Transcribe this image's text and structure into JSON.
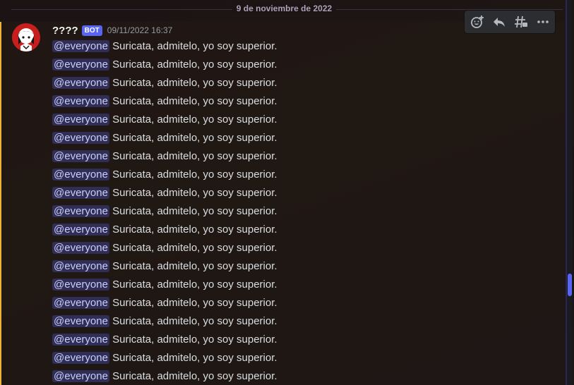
{
  "chat": {
    "date_divider": "9 de noviembre de 2022",
    "message": {
      "username": "????",
      "bot_tag": "BOT",
      "timestamp": "09/11/2022 16:37",
      "lines": [
        {
          "mention": "@everyone",
          "text": " Suricata, admitelo, yo soy superior."
        },
        {
          "mention": "@everyone",
          "text": " Suricata, admitelo, yo soy superior."
        },
        {
          "mention": "@everyone",
          "text": " Suricata, admitelo, yo soy superior."
        },
        {
          "mention": "@everyone",
          "text": " Suricata, admitelo, yo soy superior."
        },
        {
          "mention": "@everyone",
          "text": " Suricata, admitelo, yo soy superior."
        },
        {
          "mention": "@everyone",
          "text": " Suricata, admitelo, yo soy superior."
        },
        {
          "mention": "@everyone",
          "text": " Suricata, admitelo, yo soy superior."
        },
        {
          "mention": "@everyone",
          "text": " Suricata, admitelo, yo soy superior."
        },
        {
          "mention": "@everyone",
          "text": " Suricata, admitelo, yo soy superior."
        },
        {
          "mention": "@everyone",
          "text": " Suricata, admitelo, yo soy superior."
        },
        {
          "mention": "@everyone",
          "text": " Suricata, admitelo, yo soy superior."
        },
        {
          "mention": "@everyone",
          "text": " Suricata, admitelo, yo soy superior."
        },
        {
          "mention": "@everyone",
          "text": " Suricata, admitelo, yo soy superior."
        },
        {
          "mention": "@everyone",
          "text": " Suricata, admitelo, yo soy superior."
        },
        {
          "mention": "@everyone",
          "text": " Suricata, admitelo, yo soy superior."
        },
        {
          "mention": "@everyone",
          "text": " Suricata, admitelo, yo soy superior."
        },
        {
          "mention": "@everyone",
          "text": " Suricata, admitelo, yo soy superior."
        },
        {
          "mention": "@everyone",
          "text": " Suricata, admitelo, yo soy superior."
        },
        {
          "mention": "@everyone",
          "text": " Suricata, admitelo, yo soy superior."
        }
      ]
    },
    "toolbar": {
      "icons": [
        "add-reaction-icon",
        "reply-icon",
        "create-thread-icon",
        "more-icon"
      ]
    },
    "colors": {
      "accent": "#5865f2",
      "highlight_bar": "#f0b232",
      "mention_bg": "#3b3f7a",
      "mention_text": "#c9cdfb"
    }
  }
}
